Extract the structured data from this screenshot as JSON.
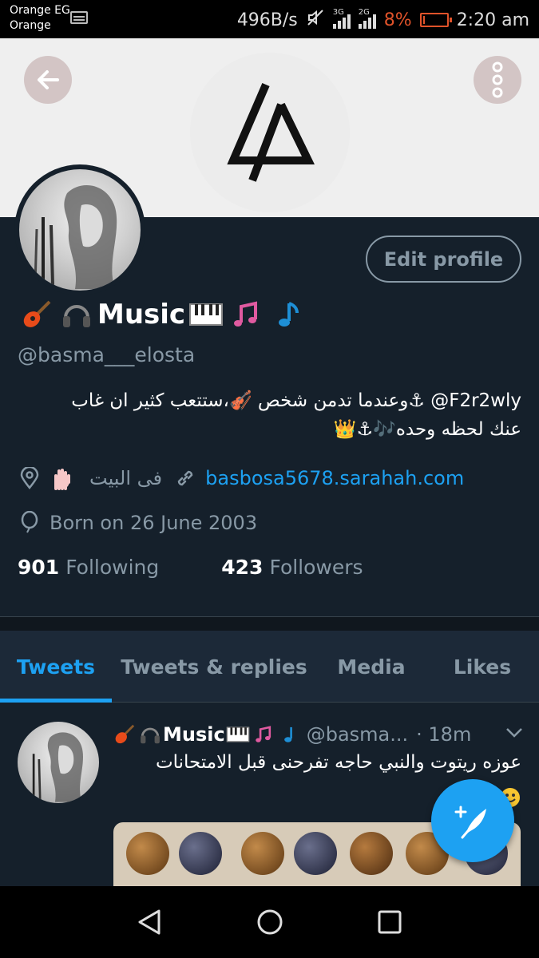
{
  "status_bar": {
    "carrier_line1": "Orange EG",
    "carrier_line2": "Orange",
    "net_speed": "496B/s",
    "sig1_label": "3G",
    "sig2_label": "2G",
    "battery_pct": "8%",
    "battery_level": 0.08,
    "time": "2:20 am"
  },
  "header": {
    "back_icon": "arrow-left-icon",
    "more_icon": "more-vertical-icon",
    "logo": "linkin-park-logo"
  },
  "profile": {
    "edit_label": "Edit profile",
    "display_name": "Music",
    "handle": "@basma___elosta",
    "bio_line1": "F2r2wly@ ⚓وعندما تدمن شخص 🎻،ستتعب كثير ان غاب",
    "bio_line2": "عنك لحظه وحده🎶⚓👑",
    "location": "فى البيت",
    "website": "basbosa5678.sarahah.com",
    "birthday": "Born on 26 June 2003",
    "following_count": "901",
    "following_label": "Following",
    "followers_count": "423",
    "followers_label": "Followers"
  },
  "tabs": [
    {
      "label": "Tweets"
    },
    {
      "label": "Tweets & replies"
    },
    {
      "label": "Media"
    },
    {
      "label": "Likes"
    }
  ],
  "tweet": {
    "name": "Music",
    "handle": "@basma...",
    "time": "· 18m",
    "text": "عوزه ريتوت والنبي حاجه تفرحنى قبل الامتحانات"
  },
  "colors": {
    "background": "#15202b",
    "accent": "#1da1f2",
    "muted": "#8899a6"
  }
}
